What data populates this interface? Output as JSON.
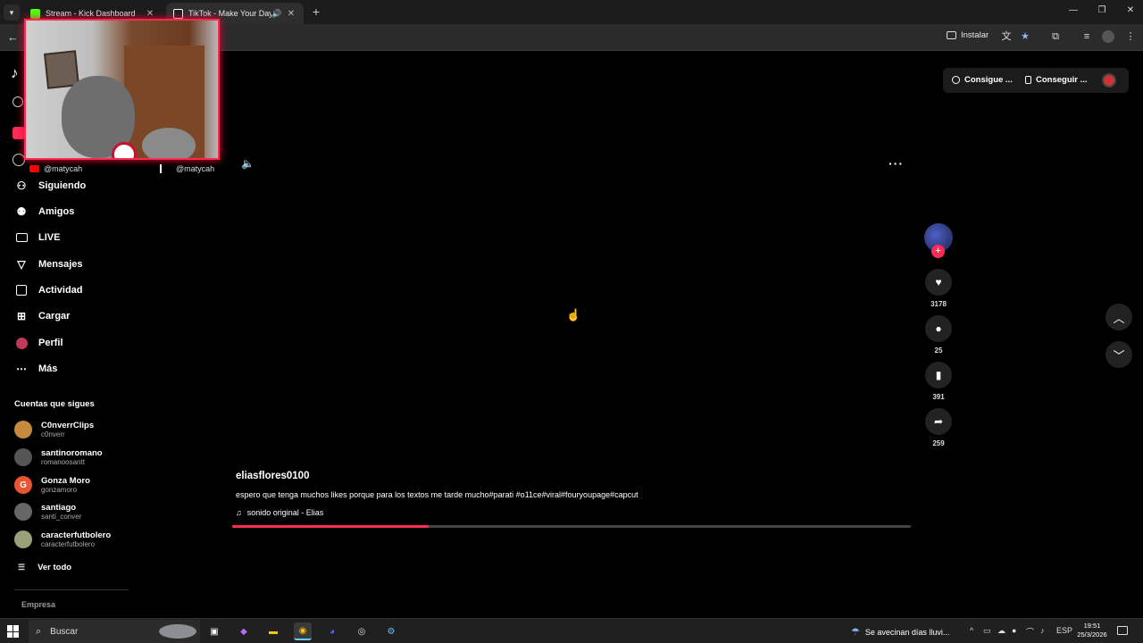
{
  "browser": {
    "tabs": [
      {
        "title": "Stream - Kick Dashboard",
        "favicon_color": "#53fc18"
      },
      {
        "title": "TikTok - Make Your Day",
        "favicon_color": "#ffffff"
      }
    ],
    "toolbar": {
      "install_label": "Instalar"
    }
  },
  "webcam": {
    "youtube_handle": "@matycah",
    "tiktok_handle": "@matycah"
  },
  "sidebar": {
    "logo_glyph": "♪",
    "nav": [
      {
        "label": "Siguiendo",
        "icon": "following-icon"
      },
      {
        "label": "Amigos",
        "icon": "friends-icon"
      },
      {
        "label": "LIVE",
        "icon": "live-icon"
      },
      {
        "label": "Mensajes",
        "icon": "messages-icon"
      },
      {
        "label": "Actividad",
        "icon": "activity-icon"
      },
      {
        "label": "Cargar",
        "icon": "upload-icon"
      },
      {
        "label": "Perfil",
        "icon": "profile-icon"
      },
      {
        "label": "Más",
        "icon": "more-icon"
      }
    ],
    "following_header": "Cuentas que sigues",
    "accounts": [
      {
        "name": "C0nverrClips",
        "username": "c0nverr",
        "color": "#c58a3b"
      },
      {
        "name": "santinoromano",
        "username": "romanoosantt",
        "color": "#555555"
      },
      {
        "name": "Gonza Moro",
        "username": "gonzamoro",
        "color": "#e8552e",
        "initial": "G"
      },
      {
        "name": "santiago",
        "username": "santi_conver",
        "color": "#666666"
      },
      {
        "name": "caracterfutbolero",
        "username": "caracterfutbolero",
        "color": "#9aa07a"
      }
    ],
    "see_all": "Ver todo",
    "footer_heading": "Empresa"
  },
  "topbar": {
    "coins_label": "Consigue ...",
    "app_label": "Conseguir ..."
  },
  "video": {
    "author": "eliasflores0100",
    "caption": "espero que tenga muchos likes porque para los textos me tarde mucho#parati #o11ce#viral#fouryoupage#capcut",
    "sound": "sonido original - Elias",
    "progress": 0.29
  },
  "actions": {
    "likes": "3178",
    "comments": "25",
    "saves": "391",
    "shares": "259"
  },
  "taskbar": {
    "search_placeholder": "Buscar",
    "weather": "Se avecinan días lluvi...",
    "language": "ESP",
    "time": "19:51",
    "date": "25/3/2026"
  },
  "colors": {
    "accent": "#fe2c55",
    "webcam_border": "#ff2a4f"
  }
}
